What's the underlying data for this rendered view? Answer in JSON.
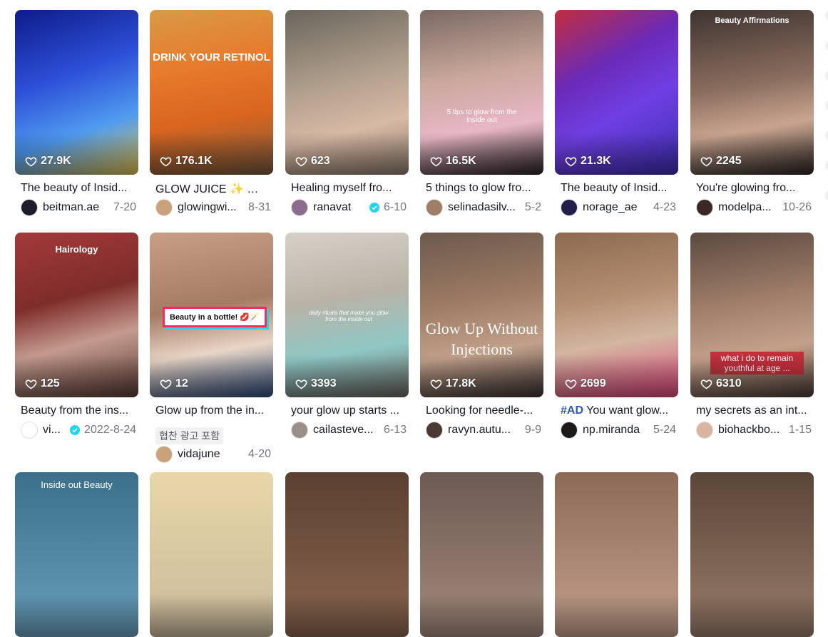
{
  "rows": [
    [
      {
        "likes": "27.9K",
        "caption": "The beauty of Insid...",
        "user": "beitman.ae",
        "date": "7-20",
        "overlay": "",
        "bg": "linear-gradient(160deg,#0e1b8a 0%,#2d50d8 40%,#4f9bef 70%,#e6c34a 100%)",
        "avatar": "#1c1c2a"
      },
      {
        "likes": "176.1K",
        "caption": "GLOW JUICE ✨ 🥕 ...",
        "user": "glowingwi...",
        "date": "8-31",
        "overlay": "DRINK YOUR RETINOL",
        "bg": "linear-gradient(170deg,#d89a47 0%,#e77a2b 35%,#d9651f 65%,#7a5a3e 100%)",
        "avatar": "#c9a27c"
      },
      {
        "likes": "623",
        "caption": "Healing myself fro...",
        "user": "ranavat",
        "date": "6-10",
        "overlay": "",
        "verified": true,
        "bg": "linear-gradient(165deg,#6a655c 0%,#b3a18e 45%,#d7b9a4 70%,#8e7d6d 100%)",
        "avatar": "#8c6d8f"
      },
      {
        "likes": "16.5K",
        "caption": "5 things to glow fro...",
        "user": "selinadasilv...",
        "date": "5-2",
        "overlay": "5 tips to glow from the inside out",
        "bg": "linear-gradient(170deg,#7a6a63 0%,#c9a79b 40%,#e8b7c6 70%,#2a2224 100%)",
        "avatar": "#a07d66"
      },
      {
        "likes": "21.3K",
        "caption": "The beauty of Insid...",
        "user": "norage_ae",
        "date": "4-23",
        "overlay": "",
        "bg": "linear-gradient(150deg,#c22d3d 0%,#6b2ab8 35%,#6f3fe3 60%,#3d2fb0 100%)",
        "avatar": "#22204a"
      },
      {
        "likes": "2245",
        "caption": "You're glowing fro...",
        "user": "modelpa...",
        "date": "10-26",
        "overlay": "Beauty Affirmations",
        "bg": "linear-gradient(170deg,#3e3430 0%,#8a6d5e 45%,#c8a48e 70%,#2c2624 100%)",
        "avatar": "#3b2a24"
      }
    ],
    [
      {
        "likes": "125",
        "caption": "Beauty from the ins...",
        "user": "vi...",
        "date": "2022-8-24",
        "overlay": "Hairology",
        "verified": true,
        "bg": "linear-gradient(165deg,#a33a3a 0%,#7e2d2a 40%,#c49a8e 65%,#5a3b34 100%)",
        "avatar": "#ffffff"
      },
      {
        "likes": "12",
        "caption": "Glow up from the in...",
        "user": "vidajune",
        "date": "4-20",
        "overlay": "Beauty in a bottle! 💋🪄",
        "ad": "협찬 광고 포함",
        "bg": "linear-gradient(170deg,#c79f86 0%,#a57b63 45%,#e8d5c6 70%,#2b4a78 100%)",
        "avatar": "#c8a37a"
      },
      {
        "likes": "3393",
        "caption": "your glow up starts ...",
        "user": "cailasteve...",
        "date": "6-13",
        "overlay": "daily rituals that make you glow from the inside out",
        "bg": "linear-gradient(170deg,#d6d1c7 0%,#b9b3a7 40%,#8fc7c4 70%,#6a6660 100%)",
        "avatar": "#9a8f86"
      },
      {
        "likes": "17.8K",
        "caption": "Looking for needle-...",
        "user": "ravyn.autu...",
        "date": "9-9",
        "overlay": "Glow Up Without Injections",
        "bg": "linear-gradient(170deg,#6c5a4e 0%,#9c7a62 40%,#c1a08a 70%,#3b3230 100%)",
        "avatar": "#4b3a33"
      },
      {
        "likes": "2699",
        "caption": "You want glow...",
        "hashtag": "#AD",
        "user": "np.miranda",
        "date": "5-24",
        "overlay": "",
        "bg": "linear-gradient(170deg,#8c6a50 0%,#b58e72 40%,#d2b6a0 65%,#e0457c 100%)",
        "avatar": "#1d1a1a"
      },
      {
        "likes": "6310",
        "caption": "my secrets as an int...",
        "user": "biohackbo...",
        "date": "1-15",
        "overlay": "what i do to remain youthful at age ...",
        "bg": "linear-gradient(170deg,#5b4a40 0%,#9c7b67 40%,#c4a08a 70%,#4a3c35 100%)",
        "avatar": "#d9b4a0"
      }
    ],
    [
      {
        "overlay": "Inside out Beauty",
        "bg": "linear-gradient(180deg,#3b6f8a 0%,#6aa0bd 100%)"
      },
      {
        "overlay": "",
        "bg": "linear-gradient(180deg,#e7d7a8 0%,#c9b99a 100%)"
      },
      {
        "overlay": "",
        "bg": "linear-gradient(180deg,#5c4030 0%,#8a6650 100%)"
      },
      {
        "overlay": "",
        "bg": "linear-gradient(180deg,#6d5a52 0%,#a38a7c 100%)"
      },
      {
        "overlay": "",
        "bg": "linear-gradient(180deg,#8c6a58 0%,#c4a08c 100%)"
      },
      {
        "overlay": "",
        "bg": "linear-gradient(180deg,#5a4638 0%,#9a7d6b 100%)"
      }
    ]
  ]
}
